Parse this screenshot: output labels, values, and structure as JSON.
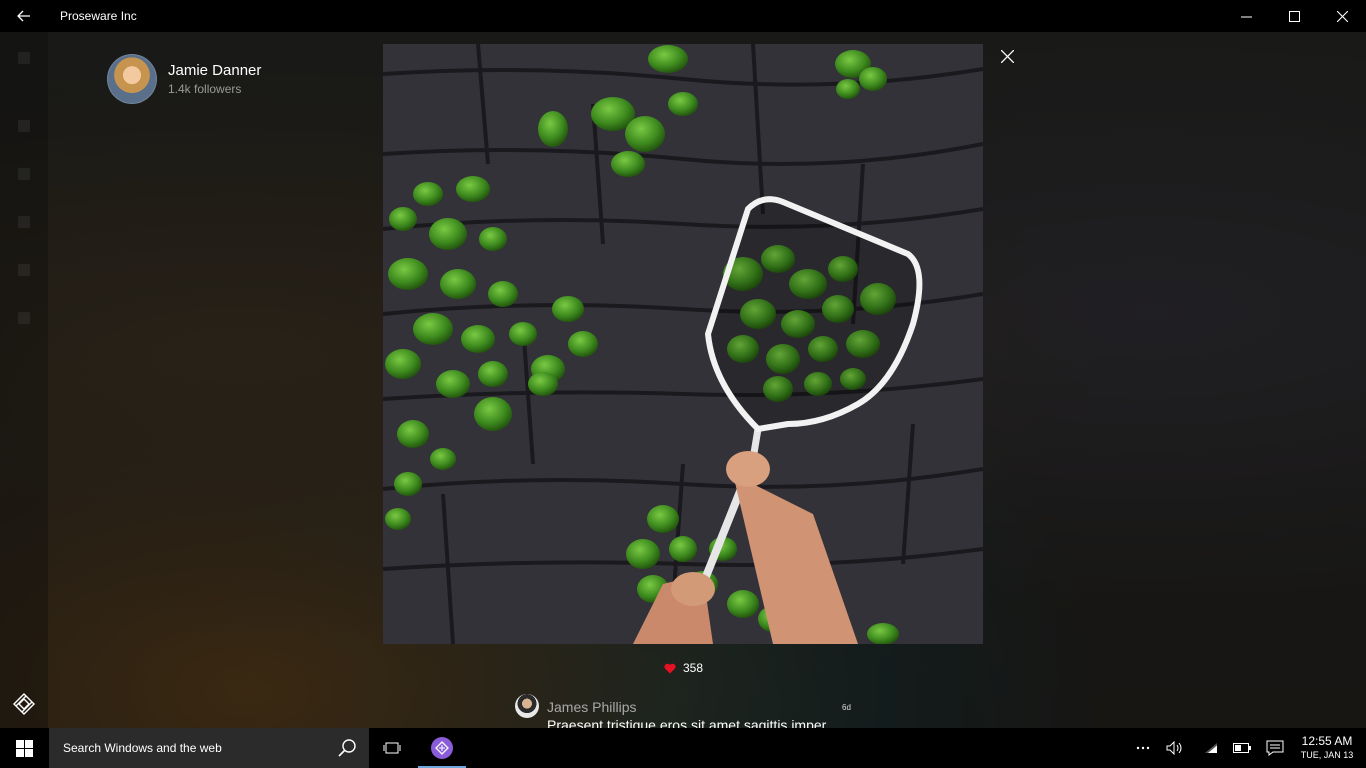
{
  "window": {
    "title": "Proseware Inc"
  },
  "profile": {
    "name": "Jamie Danner",
    "followers": "1.4k followers"
  },
  "post": {
    "likes": "358"
  },
  "comment": {
    "author": "James Phillips",
    "time": "6d",
    "text": "Praesent tristique eros sit amet sagittis imper"
  },
  "taskbar": {
    "search_placeholder": "Search Windows and the web",
    "time": "12:55 AM",
    "date": "TUE, JAN 13"
  },
  "colors": {
    "accent": "#6fa8dc",
    "heart": "#e81123",
    "app_icon": "#8a5cd8"
  }
}
